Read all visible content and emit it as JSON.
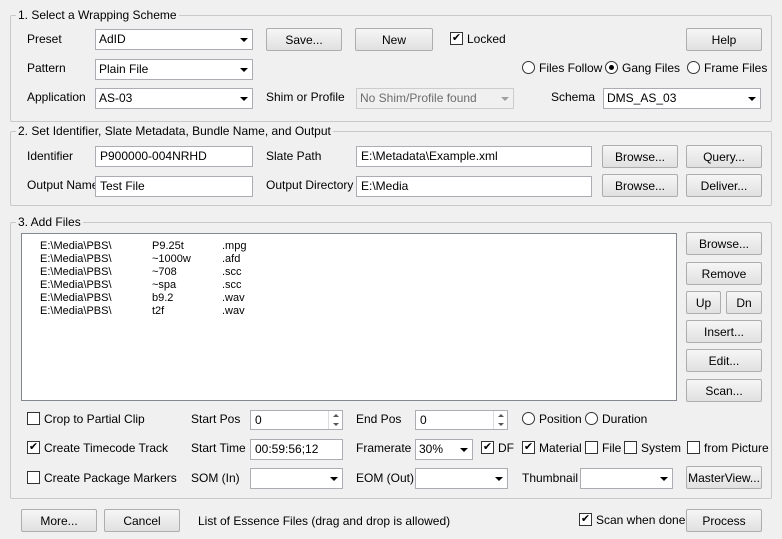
{
  "section1": {
    "title": "1. Select a Wrapping Scheme",
    "preset_label": "Preset",
    "preset_value": "AdID",
    "save_button": "Save...",
    "new_button": "New",
    "locked_label": "Locked",
    "locked_checked": true,
    "help_button": "Help",
    "pattern_label": "Pattern",
    "pattern_value": "Plain File",
    "files_follow_label": "Files Follow",
    "gang_files_label": "Gang Files",
    "frame_files_label": "Frame Files",
    "selected_mode": "Gang Files",
    "application_label": "Application",
    "application_value": "AS-03",
    "shim_label": "Shim or Profile",
    "shim_value": "No Shim/Profile found",
    "schema_label": "Schema",
    "schema_value": "DMS_AS_03"
  },
  "section2": {
    "title": "2. Set Identifier, Slate Metadata, Bundle Name, and Output",
    "identifier_label": "Identifier",
    "identifier_value": "P900000-004NRHD",
    "slate_path_label": "Slate Path",
    "slate_path_value": "E:\\Metadata\\Example.xml",
    "browse_button": "Browse...",
    "query_button": "Query...",
    "output_name_label": "Output Name",
    "output_name_value": "Test File",
    "output_dir_label": "Output Directory",
    "output_dir_value": "E:\\Media",
    "browse2_button": "Browse...",
    "deliver_button": "Deliver..."
  },
  "section3": {
    "title": "3. Add Files",
    "files": [
      {
        "path": "E:\\Media\\PBS\\",
        "name": "P9.25t",
        "ext": ".mpg"
      },
      {
        "path": "E:\\Media\\PBS\\",
        "name": "~1000w",
        "ext": ".afd"
      },
      {
        "path": "E:\\Media\\PBS\\",
        "name": "~708",
        "ext": ".scc"
      },
      {
        "path": "E:\\Media\\PBS\\",
        "name": "~spa",
        "ext": ".scc"
      },
      {
        "path": "E:\\Media\\PBS\\",
        "name": "b9.2",
        "ext": ".wav"
      },
      {
        "path": "E:\\Media\\PBS\\",
        "name": "t2f",
        "ext": ".wav"
      }
    ],
    "browse_button": "Browse...",
    "remove_button": "Remove",
    "up_button": "Up",
    "dn_button": "Dn",
    "insert_button": "Insert...",
    "edit_button": "Edit...",
    "scan_button": "Scan...",
    "crop_label": "Crop to Partial Clip",
    "crop_checked": false,
    "start_pos_label": "Start Pos",
    "start_pos_value": "0",
    "end_pos_label": "End Pos",
    "end_pos_value": "0",
    "position_label": "Position",
    "duration_label": "Duration",
    "create_timecode_label": "Create Timecode Track",
    "create_timecode_checked": true,
    "start_time_label": "Start Time",
    "start_time_value": "00:59:56;12",
    "framerate_label": "Framerate",
    "framerate_value": "30%",
    "df_label": "DF",
    "df_checked": true,
    "material_label": "Material",
    "material_checked": true,
    "file_label": "File",
    "file_checked": false,
    "system_label": "System",
    "system_checked": false,
    "from_picture_label": "from Picture",
    "from_picture_checked": false,
    "create_markers_label": "Create Package Markers",
    "create_markers_checked": false,
    "som_label": "SOM (In)",
    "som_value": "",
    "eom_label": "EOM (Out)",
    "eom_value": "",
    "thumbnail_label": "Thumbnail",
    "thumbnail_value": "",
    "masterview_button": "MasterView..."
  },
  "footer": {
    "more_button": "More...",
    "cancel_button": "Cancel",
    "hint": "List of Essence Files (drag and drop is allowed)",
    "scan_when_done_label": "Scan when done",
    "scan_when_done_checked": true,
    "process_button": "Process"
  }
}
